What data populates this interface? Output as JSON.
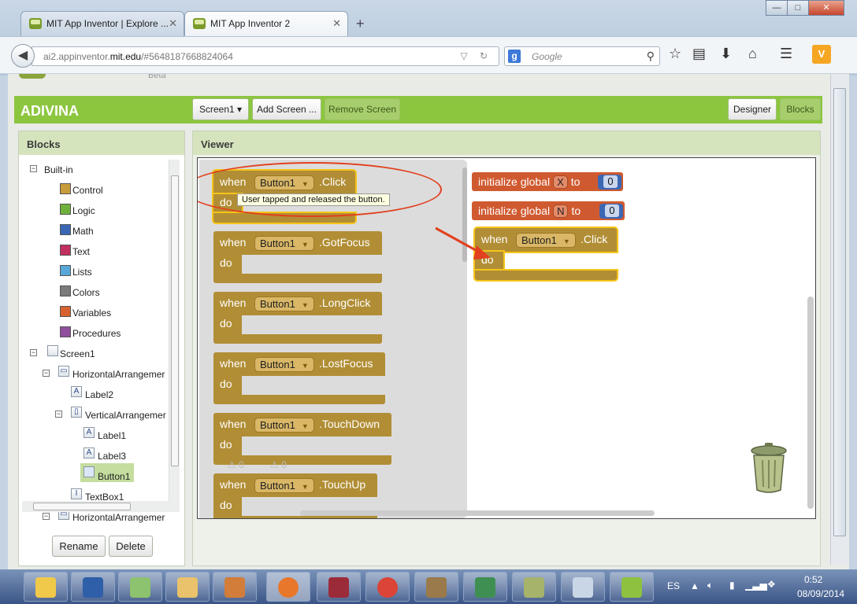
{
  "browser": {
    "tabs": [
      {
        "title": "MIT App Inventor | Explore ...",
        "active": false
      },
      {
        "title": "MIT App Inventor 2",
        "active": true
      }
    ],
    "new_tab_icon": "plus-icon",
    "url_prefix": "ai2.appinventor.",
    "url_domain": "mit.edu",
    "url_suffix": "/#5648187668824064",
    "search_placeholder": "Google",
    "search_logo": "g",
    "window_controls": {
      "minimize": "—",
      "maximize": "□",
      "close": "✕"
    }
  },
  "page": {
    "beta_label": "Beta",
    "project_name": "ADIVINA",
    "screen_dropdown": "Screen1 ▾",
    "add_screen": "Add Screen ...",
    "remove_screen": "Remove Screen",
    "designer": "Designer",
    "blocks": "Blocks"
  },
  "blocks_panel": {
    "title": "Blocks",
    "builtin_label": "Built-in",
    "builtin": [
      {
        "label": "Control",
        "color": "#c89c3a"
      },
      {
        "label": "Logic",
        "color": "#6fb13c"
      },
      {
        "label": "Math",
        "color": "#3a67b5"
      },
      {
        "label": "Text",
        "color": "#c1305e"
      },
      {
        "label": "Lists",
        "color": "#57a7d8"
      },
      {
        "label": "Colors",
        "color": "#7b7b7b"
      },
      {
        "label": "Variables",
        "color": "#d8622f"
      },
      {
        "label": "Procedures",
        "color": "#8f4f9d"
      }
    ],
    "components": {
      "screen": "Screen1",
      "ha1": "HorizontalArrangemer",
      "label2": "Label2",
      "va1": "VerticalArrangemer",
      "label1": "Label1",
      "label3": "Label3",
      "button1": "Button1",
      "textbox1": "TextBox1",
      "ha2": "HorizontalArrangemer"
    },
    "rename": "Rename",
    "delete": "Delete"
  },
  "viewer": {
    "title": "Viewer",
    "keyword_when": "when",
    "keyword_do": "do",
    "component": "Button1",
    "flyout_events": [
      ".Click",
      ".GotFocus",
      ".LongClick",
      ".LostFocus",
      ".TouchDown",
      ".TouchUp"
    ],
    "tooltip": "User tapped and released the button.",
    "warnings": "0",
    "errors": "0",
    "globals": [
      {
        "prefix": "initialize global",
        "name": "X",
        "to": "to",
        "value": "0"
      },
      {
        "prefix": "initialize global",
        "name": "N",
        "to": "to",
        "value": "0"
      }
    ],
    "placed_event": ".Click",
    "annotation_color": "#e2401e"
  },
  "taskbar": {
    "lang": "ES",
    "time": "0:52",
    "date": "08/09/2014"
  }
}
